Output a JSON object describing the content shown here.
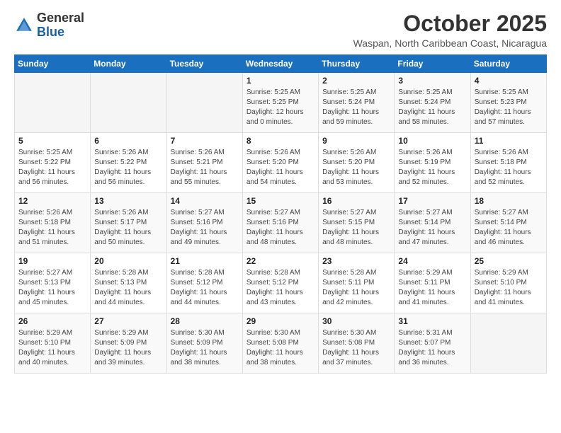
{
  "logo": {
    "general": "General",
    "blue": "Blue"
  },
  "header": {
    "month": "October 2025",
    "location": "Waspan, North Caribbean Coast, Nicaragua"
  },
  "weekdays": [
    "Sunday",
    "Monday",
    "Tuesday",
    "Wednesday",
    "Thursday",
    "Friday",
    "Saturday"
  ],
  "weeks": [
    [
      {
        "day": "",
        "info": ""
      },
      {
        "day": "",
        "info": ""
      },
      {
        "day": "",
        "info": ""
      },
      {
        "day": "1",
        "info": "Sunrise: 5:25 AM\nSunset: 5:25 PM\nDaylight: 12 hours\nand 0 minutes."
      },
      {
        "day": "2",
        "info": "Sunrise: 5:25 AM\nSunset: 5:24 PM\nDaylight: 11 hours\nand 59 minutes."
      },
      {
        "day": "3",
        "info": "Sunrise: 5:25 AM\nSunset: 5:24 PM\nDaylight: 11 hours\nand 58 minutes."
      },
      {
        "day": "4",
        "info": "Sunrise: 5:25 AM\nSunset: 5:23 PM\nDaylight: 11 hours\nand 57 minutes."
      }
    ],
    [
      {
        "day": "5",
        "info": "Sunrise: 5:25 AM\nSunset: 5:22 PM\nDaylight: 11 hours\nand 56 minutes."
      },
      {
        "day": "6",
        "info": "Sunrise: 5:26 AM\nSunset: 5:22 PM\nDaylight: 11 hours\nand 56 minutes."
      },
      {
        "day": "7",
        "info": "Sunrise: 5:26 AM\nSunset: 5:21 PM\nDaylight: 11 hours\nand 55 minutes."
      },
      {
        "day": "8",
        "info": "Sunrise: 5:26 AM\nSunset: 5:20 PM\nDaylight: 11 hours\nand 54 minutes."
      },
      {
        "day": "9",
        "info": "Sunrise: 5:26 AM\nSunset: 5:20 PM\nDaylight: 11 hours\nand 53 minutes."
      },
      {
        "day": "10",
        "info": "Sunrise: 5:26 AM\nSunset: 5:19 PM\nDaylight: 11 hours\nand 52 minutes."
      },
      {
        "day": "11",
        "info": "Sunrise: 5:26 AM\nSunset: 5:18 PM\nDaylight: 11 hours\nand 52 minutes."
      }
    ],
    [
      {
        "day": "12",
        "info": "Sunrise: 5:26 AM\nSunset: 5:18 PM\nDaylight: 11 hours\nand 51 minutes."
      },
      {
        "day": "13",
        "info": "Sunrise: 5:26 AM\nSunset: 5:17 PM\nDaylight: 11 hours\nand 50 minutes."
      },
      {
        "day": "14",
        "info": "Sunrise: 5:27 AM\nSunset: 5:16 PM\nDaylight: 11 hours\nand 49 minutes."
      },
      {
        "day": "15",
        "info": "Sunrise: 5:27 AM\nSunset: 5:16 PM\nDaylight: 11 hours\nand 48 minutes."
      },
      {
        "day": "16",
        "info": "Sunrise: 5:27 AM\nSunset: 5:15 PM\nDaylight: 11 hours\nand 48 minutes."
      },
      {
        "day": "17",
        "info": "Sunrise: 5:27 AM\nSunset: 5:14 PM\nDaylight: 11 hours\nand 47 minutes."
      },
      {
        "day": "18",
        "info": "Sunrise: 5:27 AM\nSunset: 5:14 PM\nDaylight: 11 hours\nand 46 minutes."
      }
    ],
    [
      {
        "day": "19",
        "info": "Sunrise: 5:27 AM\nSunset: 5:13 PM\nDaylight: 11 hours\nand 45 minutes."
      },
      {
        "day": "20",
        "info": "Sunrise: 5:28 AM\nSunset: 5:13 PM\nDaylight: 11 hours\nand 44 minutes."
      },
      {
        "day": "21",
        "info": "Sunrise: 5:28 AM\nSunset: 5:12 PM\nDaylight: 11 hours\nand 44 minutes."
      },
      {
        "day": "22",
        "info": "Sunrise: 5:28 AM\nSunset: 5:12 PM\nDaylight: 11 hours\nand 43 minutes."
      },
      {
        "day": "23",
        "info": "Sunrise: 5:28 AM\nSunset: 5:11 PM\nDaylight: 11 hours\nand 42 minutes."
      },
      {
        "day": "24",
        "info": "Sunrise: 5:29 AM\nSunset: 5:11 PM\nDaylight: 11 hours\nand 41 minutes."
      },
      {
        "day": "25",
        "info": "Sunrise: 5:29 AM\nSunset: 5:10 PM\nDaylight: 11 hours\nand 41 minutes."
      }
    ],
    [
      {
        "day": "26",
        "info": "Sunrise: 5:29 AM\nSunset: 5:10 PM\nDaylight: 11 hours\nand 40 minutes."
      },
      {
        "day": "27",
        "info": "Sunrise: 5:29 AM\nSunset: 5:09 PM\nDaylight: 11 hours\nand 39 minutes."
      },
      {
        "day": "28",
        "info": "Sunrise: 5:30 AM\nSunset: 5:09 PM\nDaylight: 11 hours\nand 38 minutes."
      },
      {
        "day": "29",
        "info": "Sunrise: 5:30 AM\nSunset: 5:08 PM\nDaylight: 11 hours\nand 38 minutes."
      },
      {
        "day": "30",
        "info": "Sunrise: 5:30 AM\nSunset: 5:08 PM\nDaylight: 11 hours\nand 37 minutes."
      },
      {
        "day": "31",
        "info": "Sunrise: 5:31 AM\nSunset: 5:07 PM\nDaylight: 11 hours\nand 36 minutes."
      },
      {
        "day": "",
        "info": ""
      }
    ]
  ]
}
